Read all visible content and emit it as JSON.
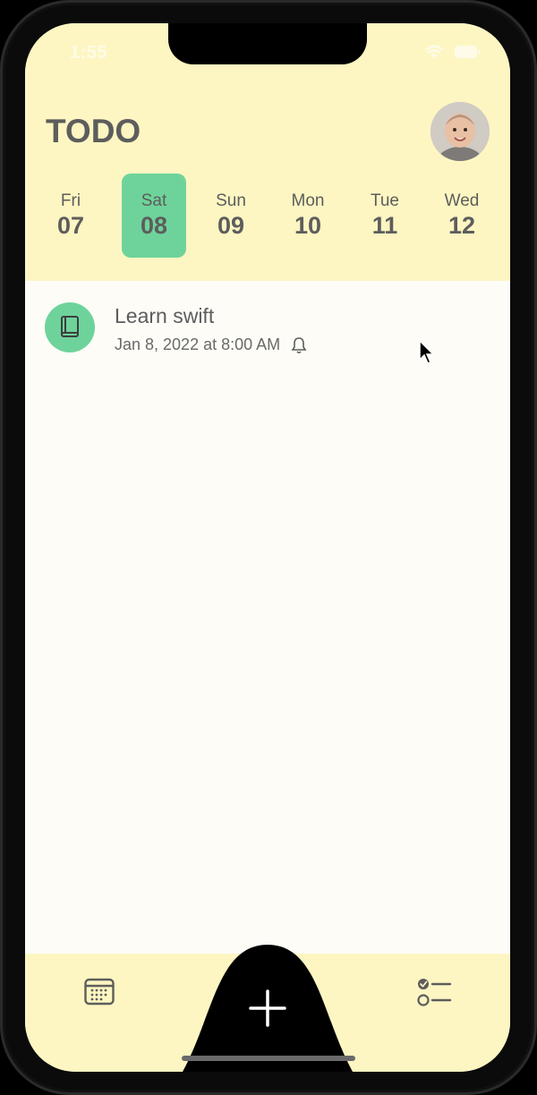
{
  "status_bar": {
    "time": "1:55"
  },
  "header": {
    "title": "TODO"
  },
  "week_days": [
    {
      "name": "Fri",
      "num": "07"
    },
    {
      "name": "Sat",
      "num": "08"
    },
    {
      "name": "Sun",
      "num": "09"
    },
    {
      "name": "Mon",
      "num": "10"
    },
    {
      "name": "Tue",
      "num": "11"
    },
    {
      "name": "Wed",
      "num": "12"
    }
  ],
  "selected_day_index": 1,
  "tasks": [
    {
      "title": "Learn swift",
      "datetime": "Jan 8, 2022 at 8:00 AM",
      "icon": "book-icon",
      "reminder_icon": "bell-icon"
    }
  ],
  "tab_bar": {
    "left_icon": "calendar-icon",
    "center_icon": "plus-icon",
    "right_icon": "checklist-icon"
  },
  "colors": {
    "header_bg": "#fdf6c2",
    "accent_green": "#6ed39b",
    "content_bg": "#fdfcf6",
    "text_gray": "#5d5d5d"
  }
}
